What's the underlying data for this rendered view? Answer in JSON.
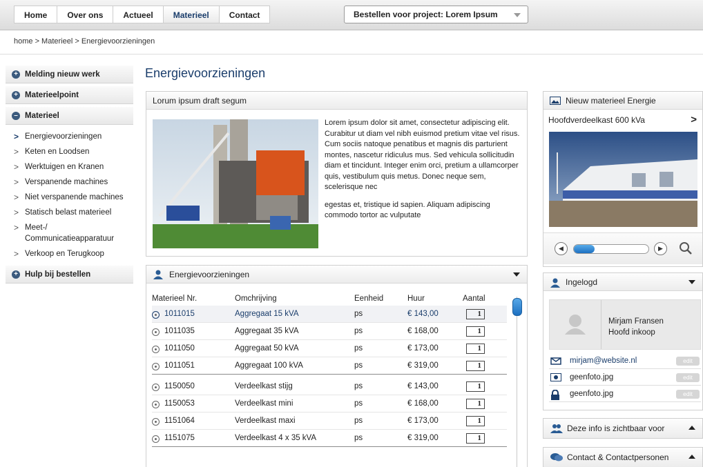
{
  "nav": {
    "items": [
      {
        "label": "Home"
      },
      {
        "label": "Over ons"
      },
      {
        "label": "Actueel"
      },
      {
        "label": "Materieel"
      },
      {
        "label": "Contact"
      }
    ],
    "project_select": "Bestellen voor project: Lorem Ipsum"
  },
  "breadcrumb": "home > Materieel > Energievoorzieningen",
  "sidebar": {
    "sections": [
      {
        "label": "Melding nieuw werk"
      },
      {
        "label": "Materieelpoint"
      },
      {
        "label": "Materieel"
      },
      {
        "label": "Hulp bij bestellen"
      }
    ],
    "submenu": [
      {
        "label": "Energievoorzieningen"
      },
      {
        "label": "Keten en Loodsen"
      },
      {
        "label": "Werktuigen en Kranen"
      },
      {
        "label": "Verspanende machines"
      },
      {
        "label": "Niet verspanende machines"
      },
      {
        "label": "Statisch belast materieel"
      },
      {
        "label": "Meet-/ Communicatieapparatuur"
      },
      {
        "label": "Verkoop en Terugkoop"
      }
    ]
  },
  "page_title": "Energievoorzieningen",
  "intro": {
    "title": "Lorum ipsum draft segum",
    "p1": "Lorem ipsum dolor sit amet, consectetur adipiscing elit. Curabitur ut diam vel nibh euismod pretium vitae vel risus. Cum sociis natoque penatibus et magnis dis parturient montes, nascetur ridiculus mus. Sed vehicula sollicitudin diam et tincidunt. Integer enim orci, pretium a ullamcorper quis, vestibulum quis metus. Donec neque sem, scelerisque nec",
    "p2": "egestas et, tristique id sapien. Aliquam adipiscing commodo tortor ac vulputate"
  },
  "equipment": {
    "title": "Energievoorzieningen",
    "headers": [
      "Materieel Nr.",
      "Omchrijving",
      "Eenheid",
      "Huur",
      "Aantal"
    ],
    "rows": [
      {
        "nr": "1011015",
        "desc": "Aggregaat 15 kVA",
        "unit": "ps",
        "price": "€ 143,00",
        "qty": "1"
      },
      {
        "nr": "1011035",
        "desc": "Aggregaat 35 kVA",
        "unit": "ps",
        "price": "€ 168,00",
        "qty": "1"
      },
      {
        "nr": "1011050",
        "desc": "Aggregaat 50 kVA",
        "unit": "ps",
        "price": "€ 173,00",
        "qty": "1"
      },
      {
        "nr": "1011051",
        "desc": "Aggregaat 100 kVA",
        "unit": "ps",
        "price": "€ 319,00",
        "qty": "1"
      },
      {
        "nr": "1150050",
        "desc": "Verdeelkast stijg",
        "unit": "ps",
        "price": "€ 143,00",
        "qty": "1"
      },
      {
        "nr": "1150053",
        "desc": "Verdeelkast mini",
        "unit": "ps",
        "price": "€ 168,00",
        "qty": "1"
      },
      {
        "nr": "1151064",
        "desc": "Verdeelkast maxi",
        "unit": "ps",
        "price": "€ 173,00",
        "qty": "1"
      },
      {
        "nr": "1151075",
        "desc": "Verdeelkast 4 x 35 kVA",
        "unit": "ps",
        "price": "€ 319,00",
        "qty": "1"
      }
    ],
    "scroll_position": 0.05
  },
  "new_equipment": {
    "title": "Nieuw materieel Energie",
    "item": "Hoofdverdeelkast 600 kVa",
    "slider_progress": 0.28
  },
  "user": {
    "title": "Ingelogd",
    "name": "Mirjam Fransen",
    "role": "Hoofd inkoop",
    "email": "mirjam@website.nl",
    "photo1": "geenfoto.jpg",
    "photo2": "geenfoto.jpg",
    "edit_label": "edit"
  },
  "visibility": {
    "title": "Deze info is zichtbaar voor"
  },
  "contacts": {
    "title": "Contact & Contactpersonen"
  },
  "colors": {
    "accent": "#1a3d6b",
    "scroll": "#1c6fc0"
  }
}
